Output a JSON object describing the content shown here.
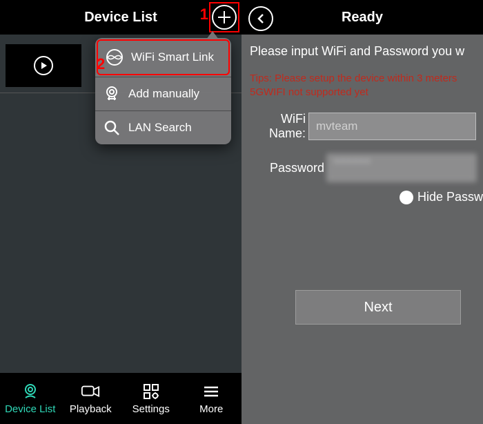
{
  "annotations": {
    "step1": "1",
    "step2": "2"
  },
  "left": {
    "title": "Device List",
    "popup": {
      "wifi_smart_link": "WiFi Smart Link",
      "add_manually": "Add manually",
      "lan_search": "LAN Search"
    },
    "tabs": {
      "device_list": "Device List",
      "playback": "Playback",
      "settings": "Settings",
      "more": "More"
    }
  },
  "right": {
    "title": "Ready",
    "instruction": "Please input WiFi and Password you w",
    "tips_line1": "Tips: Please setup the device within 3 meters",
    "tips_line2": "5GWIFI not supported yet",
    "wifi_label": "WiFi Name:",
    "wifi_value": "mvteam",
    "password_label": "Password",
    "password_value": "••••••",
    "hide_password": "Hide Passw",
    "next": "Next"
  }
}
